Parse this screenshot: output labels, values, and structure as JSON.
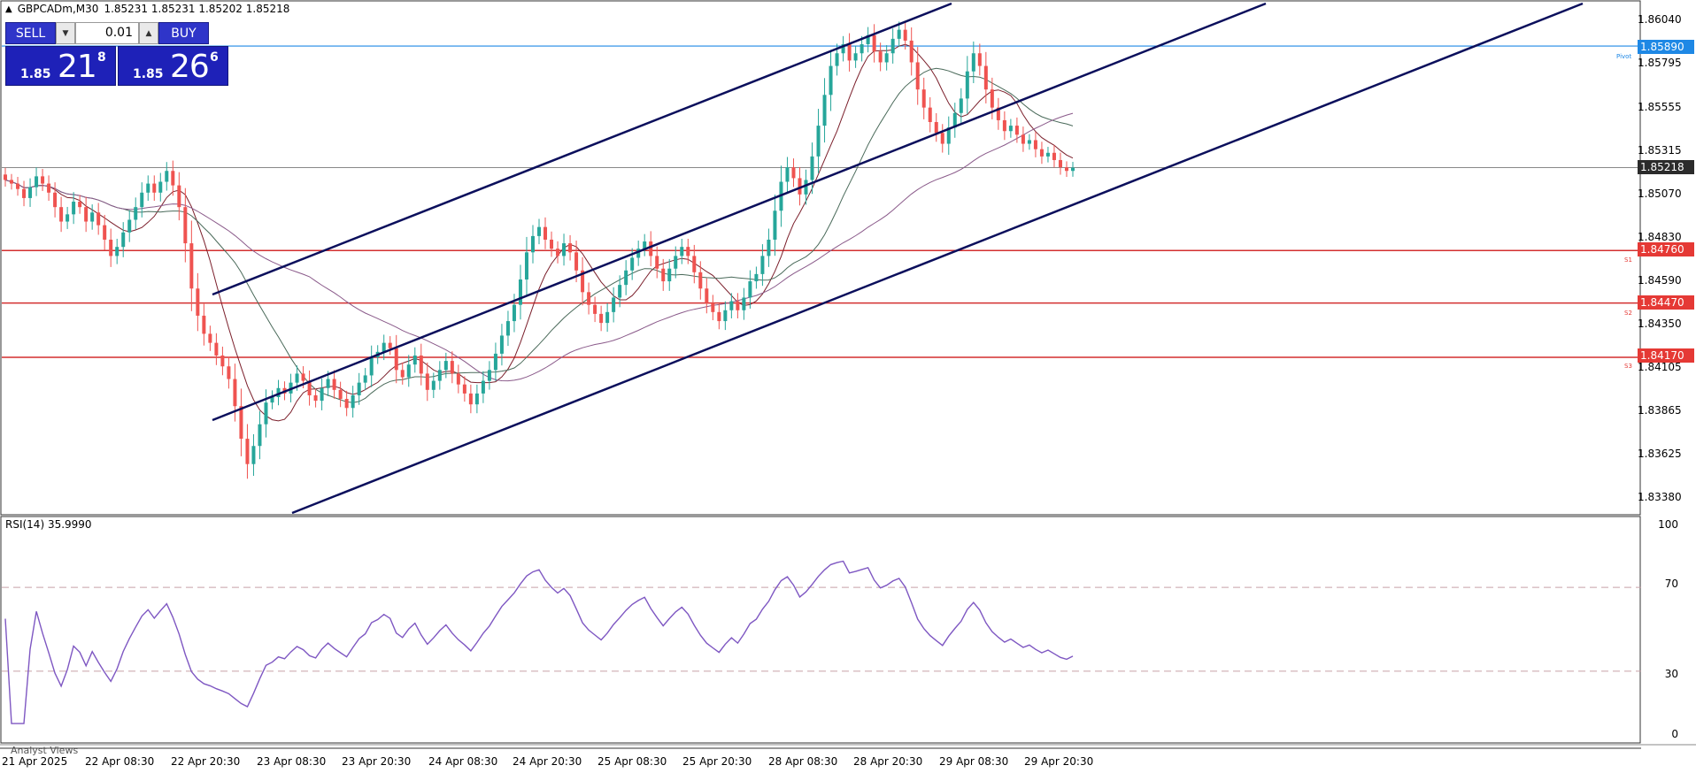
{
  "header": {
    "symbol_timeframe": "GBPCADm,M30",
    "ohlc": "1.85231 1.85231 1.85202 1.85218"
  },
  "trade_panel": {
    "sell_label": "SELL",
    "buy_label": "BUY",
    "volume": "0.01",
    "sell_quote": {
      "small": "1.85",
      "big": "21",
      "sup": "8"
    },
    "buy_quote": {
      "small": "1.85",
      "big": "26",
      "sup": "6"
    }
  },
  "price_axis": {
    "ticks": [
      "1.86040",
      "1.85795",
      "1.85555",
      "1.85315",
      "1.85070",
      "1.84830",
      "1.84590",
      "1.84350",
      "1.84105",
      "1.83865",
      "1.83625",
      "1.83380"
    ],
    "current_price": "1.85218",
    "pivot_price": "1.85890",
    "s1_price": "1.84760",
    "s2_price": "1.84470",
    "s3_price": "1.84170"
  },
  "level_tags": {
    "pivot": "Pivot",
    "s1": "S1",
    "s2": "S2",
    "s3": "S3"
  },
  "time_axis": [
    "21 Apr 2025",
    "22 Apr 08:30",
    "22 Apr 20:30",
    "23 Apr 08:30",
    "23 Apr 20:30",
    "24 Apr 08:30",
    "24 Apr 20:30",
    "25 Apr 08:30",
    "25 Apr 20:30",
    "28 Apr 08:30",
    "28 Apr 20:30",
    "29 Apr 08:30",
    "29 Apr 20:30"
  ],
  "rsi": {
    "label": "RSI(14) 35.9990",
    "levels": [
      "100",
      "70",
      "30",
      "0"
    ]
  },
  "analyst_views": "Analyst Views",
  "colors": {
    "bull": "#26a69a",
    "bear": "#ef5350",
    "channel": "#0b0f5c",
    "support": "#d32f2f",
    "pivot": "#1e88e5",
    "rsi_line": "#7e57c2"
  },
  "chart_data": {
    "type": "candlestick",
    "symbol": "GBPCADm",
    "timeframe": "M30",
    "ylim": [
      1.833,
      1.8612
    ],
    "x_ticks": [
      "21 Apr 2025",
      "22 Apr 08:30",
      "22 Apr 20:30",
      "23 Apr 08:30",
      "23 Apr 20:30",
      "24 Apr 08:30",
      "24 Apr 20:30",
      "25 Apr 08:30",
      "25 Apr 20:30",
      "28 Apr 08:30",
      "28 Apr 20:30",
      "29 Apr 08:30",
      "29 Apr 20:30"
    ],
    "closes": [
      1.8515,
      1.8513,
      1.851,
      1.8505,
      1.8511,
      1.8517,
      1.8513,
      1.8508,
      1.85,
      1.8492,
      1.8496,
      1.8503,
      1.85,
      1.8492,
      1.8497,
      1.849,
      1.8482,
      1.8473,
      1.8478,
      1.8486,
      1.8493,
      1.85,
      1.8508,
      1.8513,
      1.8508,
      1.8514,
      1.852,
      1.8512,
      1.85,
      1.848,
      1.8455,
      1.844,
      1.843,
      1.8425,
      1.8418,
      1.8412,
      1.8405,
      1.839,
      1.8372,
      1.8358,
      1.8368,
      1.838,
      1.8392,
      1.8395,
      1.84,
      1.8397,
      1.8403,
      1.8408,
      1.8404,
      1.8396,
      1.8393,
      1.84,
      1.8405,
      1.8399,
      1.8394,
      1.8389,
      1.8396,
      1.8403,
      1.8407,
      1.8417,
      1.842,
      1.8425,
      1.8422,
      1.841,
      1.8406,
      1.8413,
      1.8418,
      1.8408,
      1.8399,
      1.8404,
      1.841,
      1.8415,
      1.8408,
      1.8402,
      1.8397,
      1.8391,
      1.8397,
      1.8404,
      1.841,
      1.8419,
      1.8429,
      1.8437,
      1.8446,
      1.846,
      1.8475,
      1.8484,
      1.8489,
      1.8482,
      1.8477,
      1.8473,
      1.848,
      1.8475,
      1.8465,
      1.8453,
      1.8446,
      1.8441,
      1.8436,
      1.8442,
      1.845,
      1.8457,
      1.8465,
      1.8472,
      1.8477,
      1.8481,
      1.8473,
      1.8466,
      1.8459,
      1.8466,
      1.8473,
      1.8478,
      1.8473,
      1.8464,
      1.8455,
      1.8447,
      1.8442,
      1.8437,
      1.8443,
      1.8448,
      1.8443,
      1.845,
      1.8459,
      1.8463,
      1.8473,
      1.8482,
      1.8498,
      1.8514,
      1.8522,
      1.8516,
      1.8507,
      1.8515,
      1.8528,
      1.8545,
      1.8562,
      1.8578,
      1.8585,
      1.859,
      1.8581,
      1.8585,
      1.859,
      1.8595,
      1.8586,
      1.858,
      1.8585,
      1.8593,
      1.8598,
      1.8592,
      1.858,
      1.8565,
      1.8555,
      1.8547,
      1.8541,
      1.8535,
      1.8544,
      1.8552,
      1.856,
      1.8575,
      1.8585,
      1.8578,
      1.8565,
      1.8555,
      1.8548,
      1.8542,
      1.8545,
      1.854,
      1.8535,
      1.8537,
      1.8532,
      1.8528,
      1.853,
      1.8526,
      1.8522,
      1.852,
      1.85218
    ]
  }
}
